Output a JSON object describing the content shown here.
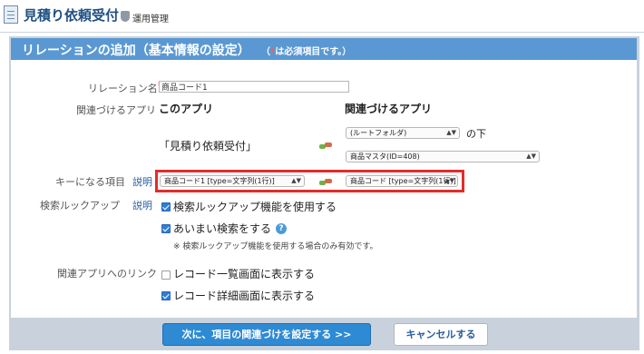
{
  "topbar": {
    "app_title": "見積り依頼受付",
    "admin_label": "運用管理"
  },
  "header": {
    "title": "リレーションの追加（基本情報の設定）",
    "note_star": "*",
    "note_text": "は必須項目です。）",
    "note_open": "（"
  },
  "form": {
    "relation_name": {
      "label": "リレーション名",
      "required_mark": "*",
      "value": "商品コード1"
    },
    "related_apps": {
      "label": "関連づけるアプリ",
      "this_app_head": "このアプリ",
      "other_app_head": "関連づけるアプリ",
      "this_app_name": "「見積り依頼受付」",
      "folder_select": "(ルートフォルダ)",
      "no_shita": "の下",
      "app_select": "商品マスタ(ID=408)"
    },
    "key_field": {
      "label": "キーになる項目",
      "help_link": "説明",
      "this_select": "商品コード1 [type=文字列(1行)]",
      "other_select": "商品コード [type=文字列(1行)]"
    },
    "lookup": {
      "label": "検索ルックアップ",
      "help_link": "説明",
      "enable_label": "検索ルックアップ機能を使用する",
      "enable_checked": true,
      "fuzzy_label": "あいまい検索をする",
      "fuzzy_checked": true,
      "help_icon": "?",
      "note": "※ 検索ルックアップ機能を使用する場合のみ有効です。"
    },
    "related_link": {
      "label": "関連アプリへのリンク",
      "list_label": "レコード一覧画面に表示する",
      "list_checked": false,
      "detail_label": "レコード詳細画面に表示する",
      "detail_checked": true
    }
  },
  "footer": {
    "next_button": "次に、項目の関連づけを設定する >>",
    "cancel_button": "キャンセルする"
  },
  "icons": {
    "app": "document-list-icon",
    "admin": "shield-icon",
    "relation": "link-icon",
    "help": "help-circle-icon"
  },
  "colors": {
    "header_bg": "#5a98d3",
    "primary_button": "#2f8ad4",
    "highlight_border": "#e52b2b",
    "title": "#1f4f82"
  }
}
